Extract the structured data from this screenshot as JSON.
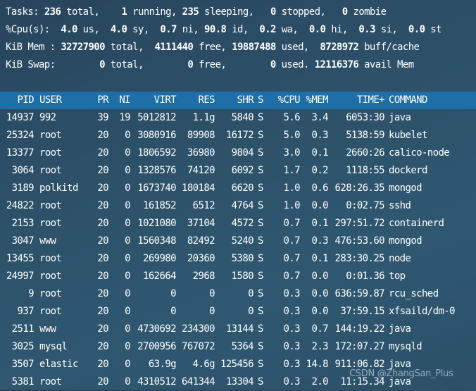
{
  "summary": {
    "tasks": {
      "label": "Tasks:",
      "total": "236",
      "total_lbl": "total,",
      "running": "1",
      "running_lbl": "running,",
      "sleeping": "235",
      "sleeping_lbl": "sleeping,",
      "stopped": "0",
      "stopped_lbl": "stopped,",
      "zombie": "0",
      "zombie_lbl": "zombie"
    },
    "cpu": {
      "label": "%Cpu(s):",
      "us": "4.0",
      "us_lbl": "us,",
      "sy": "4.0",
      "sy_lbl": "sy,",
      "ni": "0.7",
      "ni_lbl": "ni,",
      "id": "90.8",
      "id_lbl": "id,",
      "wa": "0.2",
      "wa_lbl": "wa,",
      "hi": "0.0",
      "hi_lbl": "hi,",
      "si": "0.3",
      "si_lbl": "si,",
      "st": "0.0",
      "st_lbl": "st"
    },
    "mem": {
      "label": "KiB Mem :",
      "total": "32727900",
      "total_lbl": "total,",
      "free": "4111440",
      "free_lbl": "free,",
      "used": "19887488",
      "used_lbl": "used,",
      "buff": "8728972",
      "buff_lbl": "buff/cache"
    },
    "swap": {
      "label": "KiB Swap:",
      "total": "0",
      "total_lbl": "total,",
      "free": "0",
      "free_lbl": "free,",
      "used": "0",
      "used_lbl": "used.",
      "avail": "12116376",
      "avail_lbl": "avail Mem"
    }
  },
  "columns": [
    "PID",
    "USER",
    "PR",
    "NI",
    "VIRT",
    "RES",
    "SHR",
    "S",
    "%CPU",
    "%MEM",
    "TIME+",
    "COMMAND"
  ],
  "processes": [
    [
      "14937",
      "992",
      "39",
      "19",
      "5012812",
      "1.1g",
      "5840",
      "S",
      "5.6",
      "3.4",
      "6053:30",
      "java"
    ],
    [
      "25324",
      "root",
      "20",
      "0",
      "3080916",
      "89908",
      "16172",
      "S",
      "5.0",
      "0.3",
      "5138:59",
      "kubelet"
    ],
    [
      "13377",
      "root",
      "20",
      "0",
      "1806592",
      "36980",
      "9804",
      "S",
      "3.0",
      "0.1",
      "2660:26",
      "calico-node"
    ],
    [
      "3064",
      "root",
      "20",
      "0",
      "1328576",
      "74120",
      "6092",
      "S",
      "1.7",
      "0.2",
      "1118:55",
      "dockerd"
    ],
    [
      "3189",
      "polkitd",
      "20",
      "0",
      "1673740",
      "180184",
      "6620",
      "S",
      "1.0",
      "0.6",
      "628:26.35",
      "mongod"
    ],
    [
      "24822",
      "root",
      "20",
      "0",
      "161852",
      "6512",
      "4764",
      "S",
      "1.0",
      "0.0",
      "0:02.75",
      "sshd"
    ],
    [
      "2153",
      "root",
      "20",
      "0",
      "1021080",
      "37104",
      "4572",
      "S",
      "0.7",
      "0.1",
      "297:51.72",
      "containerd"
    ],
    [
      "3047",
      "www",
      "20",
      "0",
      "1560348",
      "82492",
      "5240",
      "S",
      "0.7",
      "0.3",
      "476:53.60",
      "mongod"
    ],
    [
      "13455",
      "root",
      "20",
      "0",
      "269980",
      "20360",
      "5380",
      "S",
      "0.7",
      "0.1",
      "283:30.25",
      "node"
    ],
    [
      "24997",
      "root",
      "20",
      "0",
      "162664",
      "2968",
      "1580",
      "S",
      "0.7",
      "0.0",
      "0:01.36",
      "top"
    ],
    [
      "9",
      "root",
      "20",
      "0",
      "0",
      "0",
      "0",
      "S",
      "0.3",
      "0.0",
      "636:59.87",
      "rcu_sched"
    ],
    [
      "937",
      "root",
      "20",
      "0",
      "0",
      "0",
      "0",
      "S",
      "0.3",
      "0.0",
      "37:59.15",
      "xfsaild/dm-0"
    ],
    [
      "2511",
      "www",
      "20",
      "0",
      "4730692",
      "234300",
      "13144",
      "S",
      "0.3",
      "0.7",
      "144:19.22",
      "java"
    ],
    [
      "3025",
      "mysql",
      "20",
      "0",
      "2700956",
      "767072",
      "5364",
      "S",
      "0.3",
      "2.3",
      "172:07.27",
      "mysqld"
    ],
    [
      "3507",
      "elastic",
      "20",
      "0",
      "63.9g",
      "4.6g",
      "125456",
      "S",
      "0.3",
      "14.8",
      "911:06.82",
      "java"
    ],
    [
      "5381",
      "root",
      "20",
      "0",
      "4310512",
      "641344",
      "13304",
      "S",
      "0.3",
      "2.0",
      "11:15.34",
      "java"
    ]
  ],
  "watermark": "CSDN @ZhangSan_Plus",
  "colors": {
    "background": "#2c5068",
    "header_bar": "#1e6fa8",
    "text": "#ffffff"
  }
}
